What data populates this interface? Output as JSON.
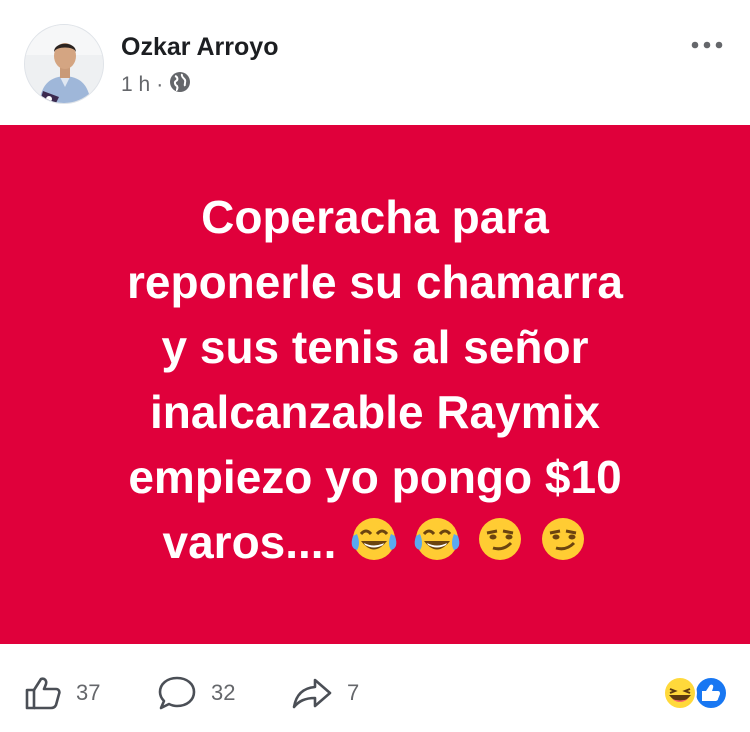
{
  "post": {
    "author": "Ozkar Arroyo",
    "time": "1 h",
    "separator": "·",
    "privacy_icon": "globe-icon",
    "more_icon": "more-options-icon",
    "body_lines": [
      "Coperacha para",
      "reponerle su chamarra",
      "y sus tenis al señor",
      "inalcanzable Raymix",
      "empiezo yo pongo $10",
      "varos...."
    ],
    "body_emojis": [
      "tears-of-joy-emoji",
      "tears-of-joy-emoji",
      "smirk-emoji",
      "smirk-emoji"
    ],
    "background_color": "#e0003b"
  },
  "footer": {
    "likes": "37",
    "comments": "32",
    "shares": "7",
    "reaction_icons": [
      "laugh-reaction-icon",
      "like-reaction-icon"
    ]
  }
}
